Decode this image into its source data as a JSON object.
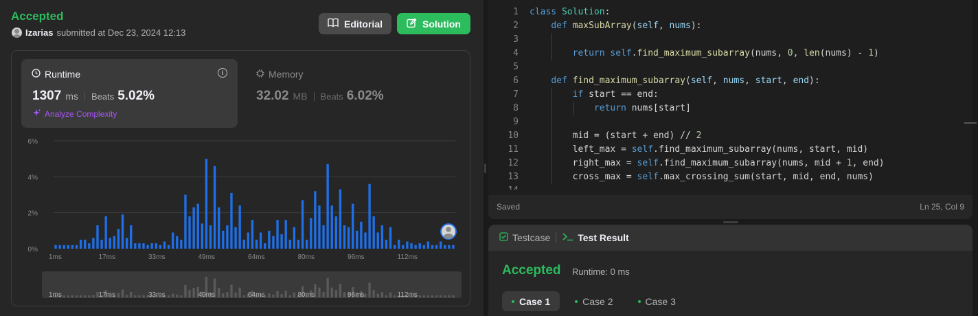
{
  "submission": {
    "status": "Accepted",
    "username": "Izarias",
    "submitted_text": "submitted at Dec 23, 2024 12:13",
    "editorial_label": "Editorial",
    "solution_label": "Solution"
  },
  "runtime": {
    "label": "Runtime",
    "value": "1307",
    "unit": "ms",
    "beats_label": "Beats",
    "beats_value": "5.02%",
    "analyze_label": "Analyze Complexity"
  },
  "memory": {
    "label": "Memory",
    "value": "32.02",
    "unit": "MB",
    "beats_label": "Beats",
    "beats_value": "6.02%"
  },
  "chart_data": {
    "type": "bar",
    "title": "",
    "xlabel": "",
    "ylabel": "",
    "ylim": [
      0,
      6
    ],
    "y_ticks": [
      "0%",
      "2%",
      "4%",
      "6%"
    ],
    "x_ticks": [
      "1ms",
      "17ms",
      "33ms",
      "49ms",
      "64ms",
      "80ms",
      "96ms",
      "112ms"
    ],
    "grid": true,
    "bar_color": "#1e6fe8",
    "values": [
      0.2,
      0.2,
      0.2,
      0.2,
      0.2,
      0.2,
      0.5,
      0.5,
      0.3,
      0.6,
      1.3,
      0.5,
      1.8,
      0.6,
      0.7,
      1.1,
      1.9,
      0.6,
      1.3,
      0.3,
      0.3,
      0.3,
      0.2,
      0.3,
      0.3,
      0.2,
      0.4,
      0.2,
      0.9,
      0.7,
      0.5,
      3.0,
      1.8,
      2.3,
      2.5,
      1.4,
      5.0,
      1.3,
      4.6,
      2.3,
      1.0,
      1.3,
      3.1,
      1.2,
      2.4,
      0.5,
      0.9,
      1.6,
      0.5,
      0.9,
      0.3,
      1.0,
      0.7,
      1.6,
      0.8,
      1.6,
      0.5,
      1.2,
      0.5,
      2.7,
      0.5,
      1.7,
      3.2,
      2.4,
      1.3,
      4.7,
      2.4,
      1.8,
      3.3,
      1.3,
      1.2,
      2.5,
      1.0,
      1.5,
      0.9,
      3.6,
      1.8,
      0.9,
      1.3,
      0.5,
      1.2,
      0.2,
      0.5,
      0.2,
      0.4,
      0.3,
      0.2,
      0.3,
      0.2,
      0.4,
      0.2,
      0.2,
      0.4,
      0.2,
      0.2,
      0.2
    ],
    "marker_label_value": 1307
  },
  "editor": {
    "lines": [
      {
        "n": "1"
      },
      {
        "n": "2"
      },
      {
        "n": "3"
      },
      {
        "n": "4"
      },
      {
        "n": "5"
      },
      {
        "n": "6"
      },
      {
        "n": "7"
      },
      {
        "n": "8"
      },
      {
        "n": "9"
      },
      {
        "n": "10"
      },
      {
        "n": "11"
      },
      {
        "n": "12"
      },
      {
        "n": "13"
      },
      {
        "n": "14"
      }
    ],
    "code": {
      "l1a": "class",
      "l1b": "Solution",
      "l2a": "def",
      "l2b": "maxSubArray",
      "l2c": "self",
      "l2d": "nums",
      "l4a": "return",
      "l4b": "self",
      "l4c": "find_maximum_subarray",
      "l4d": "nums, ",
      "l4e": "0",
      "l4f": "len",
      "l4g": "nums",
      "l4h": "1",
      "l6a": "def",
      "l6b": "find_maximum_subarray",
      "l6c": "self",
      "l6d": "nums",
      "l6e": "start",
      "l6f": "end",
      "l7a": "if",
      "l7b": "start == end:",
      "l8a": "return",
      "l8b": "nums[start]",
      "l10": "mid = (start + end) // ",
      "l10n": "2",
      "l11a": "left_max = ",
      "l11b": "self",
      "l11c": ".find_maximum_subarray(nums, start, mid)",
      "l12a": "right_max = ",
      "l12b": "self",
      "l12c": ".find_maximum_subarray(nums, mid + ",
      "l12n": "1",
      "l12d": ", end)",
      "l13a": "cross_max = ",
      "l13b": "self",
      "l13c": ".max_crossing_sum(start, mid, end, nums)"
    },
    "saved_label": "Saved",
    "cursor_pos": "Ln 25, Col 9"
  },
  "result": {
    "testcase_tab": "Testcase",
    "result_tab": "Test Result",
    "status": "Accepted",
    "runtime_text": "Runtime: 0 ms",
    "cases": [
      "Case 1",
      "Case 2",
      "Case 3"
    ],
    "active_case": 0
  }
}
